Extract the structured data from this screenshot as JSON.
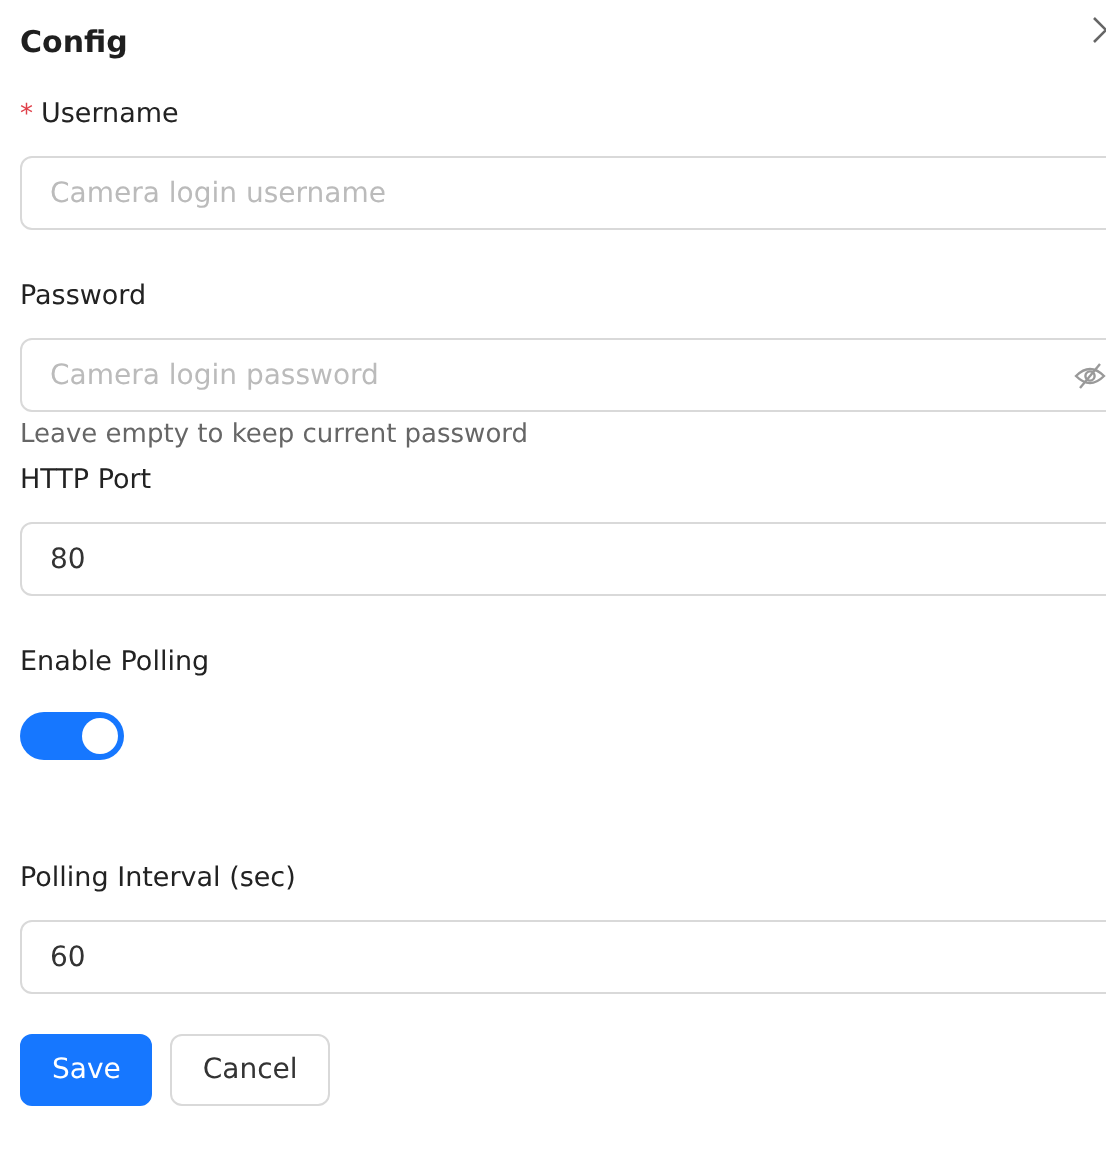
{
  "title": "Config",
  "fields": [
    {
      "kind": "input",
      "label": "Username",
      "required_mark": "*",
      "placeholder": "Camera login username"
    },
    {
      "kind": "password",
      "label": "Password",
      "placeholder": "Camera login password",
      "help": "Leave empty to keep current password"
    },
    {
      "kind": "input",
      "label": "HTTP Port",
      "value": "80"
    },
    {
      "kind": "toggle",
      "label": "Enable Polling",
      "on": true
    },
    {
      "kind": "input",
      "label": "Polling Interval (sec)",
      "value": "60"
    }
  ],
  "buttons": [
    {
      "label": "Save",
      "primary": true
    },
    {
      "label": "Cancel",
      "primary": false
    }
  ]
}
